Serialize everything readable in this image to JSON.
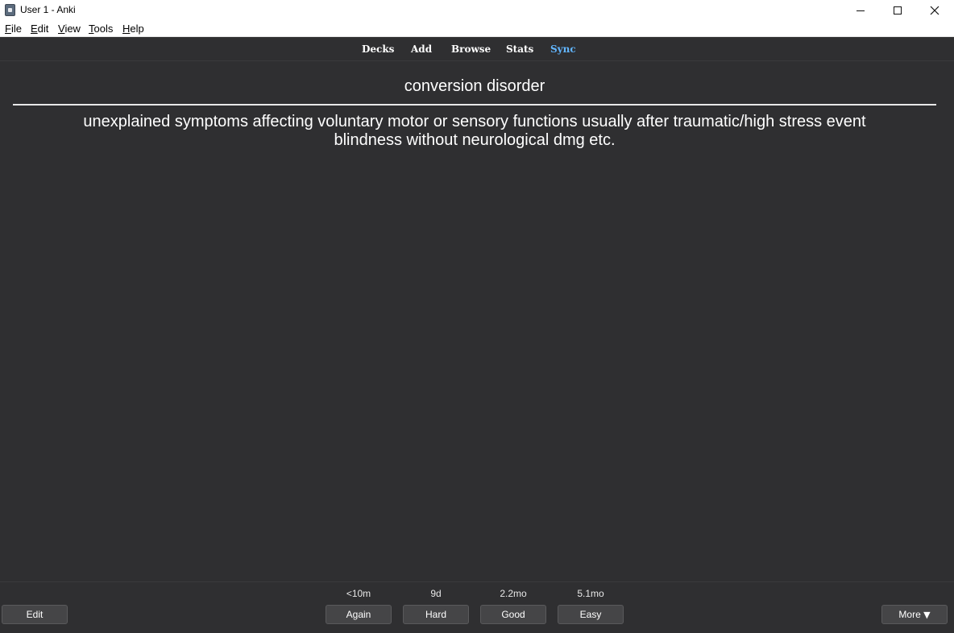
{
  "window": {
    "title": "User 1 - Anki",
    "icon": "anki-app-icon"
  },
  "menu": {
    "file": {
      "underline": "F",
      "rest": "ile"
    },
    "edit": {
      "underline": "E",
      "rest": "dit"
    },
    "view": {
      "underline": "V",
      "rest": "iew"
    },
    "tools": {
      "underline": "T",
      "rest": "ools"
    },
    "help": {
      "underline": "H",
      "rest": "elp"
    }
  },
  "toolbar": {
    "decks": "Decks",
    "add": "Add",
    "browse": "Browse",
    "stats": "Stats",
    "sync": "Sync",
    "sync_color": "#62b6ff"
  },
  "card": {
    "front": "conversion disorder",
    "back_lines": [
      "unexplained symptoms affecting voluntary motor or sensory functions usually after traumatic/high stress event",
      "blindness without neurological dmg etc."
    ]
  },
  "bottom": {
    "edit_label": "Edit",
    "answers": [
      {
        "label": "Again",
        "interval": "<10m"
      },
      {
        "label": "Hard",
        "interval": "9d"
      },
      {
        "label": "Good",
        "interval": "2.2mo"
      },
      {
        "label": "Easy",
        "interval": "5.1mo"
      }
    ],
    "more_label": "More",
    "more_arrow": "▼"
  },
  "colors": {
    "background": "#2f2f31",
    "button": "#454547",
    "text": "#ffffff"
  }
}
